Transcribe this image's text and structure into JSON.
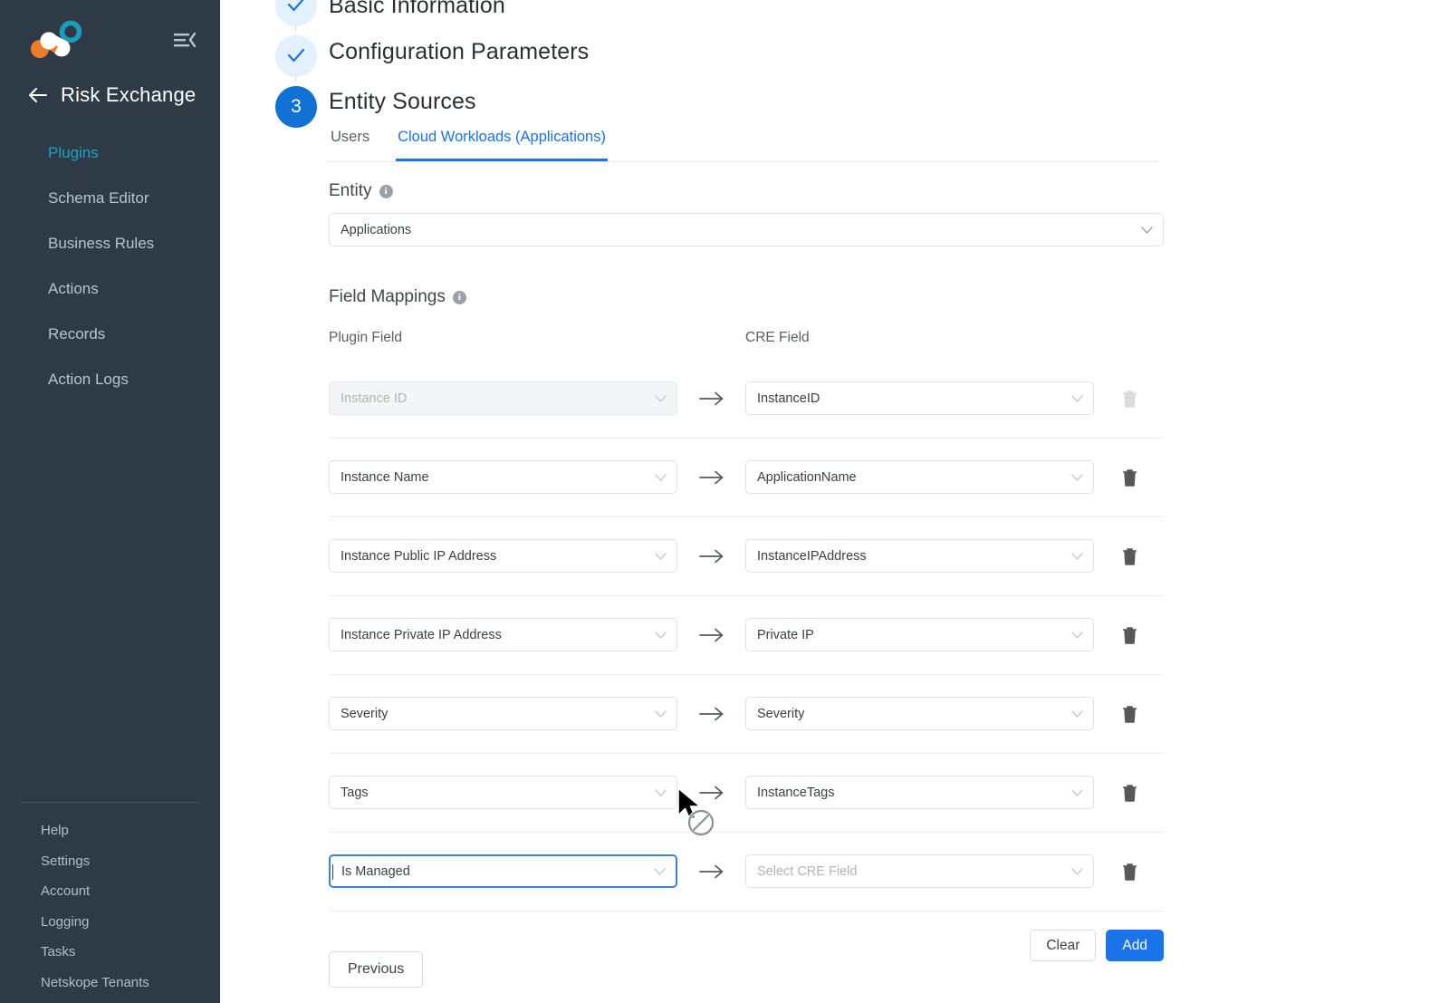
{
  "sidebar": {
    "logo_name": "netskope-logo",
    "collapse_icon": "menu-collapse-icon",
    "back_icon": "back-arrow-icon",
    "brand_title": "Risk Exchange",
    "items": [
      {
        "label": "Plugins",
        "active": true
      },
      {
        "label": "Schema Editor",
        "active": false
      },
      {
        "label": "Business Rules",
        "active": false
      },
      {
        "label": "Actions",
        "active": false
      },
      {
        "label": "Records",
        "active": false
      },
      {
        "label": "Action Logs",
        "active": false
      }
    ],
    "footer_items": [
      {
        "label": "Help"
      },
      {
        "label": "Settings"
      },
      {
        "label": "Account"
      },
      {
        "label": "Logging"
      },
      {
        "label": "Tasks"
      },
      {
        "label": "Netskope Tenants"
      }
    ]
  },
  "stepper": {
    "steps": [
      {
        "label": "Basic Information",
        "state": "done",
        "marker": "check"
      },
      {
        "label": "Configuration Parameters",
        "state": "done",
        "marker": "check"
      },
      {
        "label": "Entity Sources",
        "state": "current",
        "marker": "3"
      }
    ]
  },
  "tabs": [
    {
      "label": "Users",
      "active": false
    },
    {
      "label": "Cloud Workloads (Applications)",
      "active": true
    }
  ],
  "entity": {
    "label": "Entity",
    "info_icon": "info-icon",
    "value": "Applications"
  },
  "field_mappings": {
    "label": "Field Mappings",
    "info_icon": "info-icon",
    "columns": {
      "plugin": "Plugin Field",
      "cre": "CRE Field"
    },
    "cre_placeholder": "Select CRE Field",
    "rows": [
      {
        "plugin": "Instance ID",
        "cre": "InstanceID",
        "plugin_disabled": true,
        "cre_disabled": false,
        "delete_disabled": true
      },
      {
        "plugin": "Instance Name",
        "cre": "ApplicationName",
        "plugin_disabled": false,
        "cre_disabled": false,
        "delete_disabled": false
      },
      {
        "plugin": "Instance Public IP Address",
        "cre": "InstanceIPAddress",
        "plugin_disabled": false,
        "cre_disabled": false,
        "delete_disabled": false
      },
      {
        "plugin": "Instance Private IP Address",
        "cre": "Private IP",
        "plugin_disabled": false,
        "cre_disabled": false,
        "delete_disabled": false
      },
      {
        "plugin": "Severity",
        "cre": "Severity",
        "plugin_disabled": false,
        "cre_disabled": false,
        "delete_disabled": false
      },
      {
        "plugin": "Tags",
        "cre": "InstanceTags",
        "plugin_disabled": false,
        "cre_disabled": false,
        "delete_disabled": false
      },
      {
        "plugin": "Is Managed",
        "cre": "",
        "plugin_disabled": false,
        "cre_disabled": true,
        "delete_disabled": false,
        "focused": true,
        "cre_is_placeholder": true
      }
    ]
  },
  "buttons": {
    "clear": "Clear",
    "add": "Add",
    "previous": "Previous"
  },
  "colors": {
    "sidebar_bg": "#2e3b47",
    "accent_link": "#1fa3c4",
    "primary_blue": "#1a73e8",
    "step_current": "#1271d4",
    "step_done_bg": "#e3f0fd",
    "logo_orange": "#f07c28",
    "logo_teal": "#1a9dbd"
  }
}
